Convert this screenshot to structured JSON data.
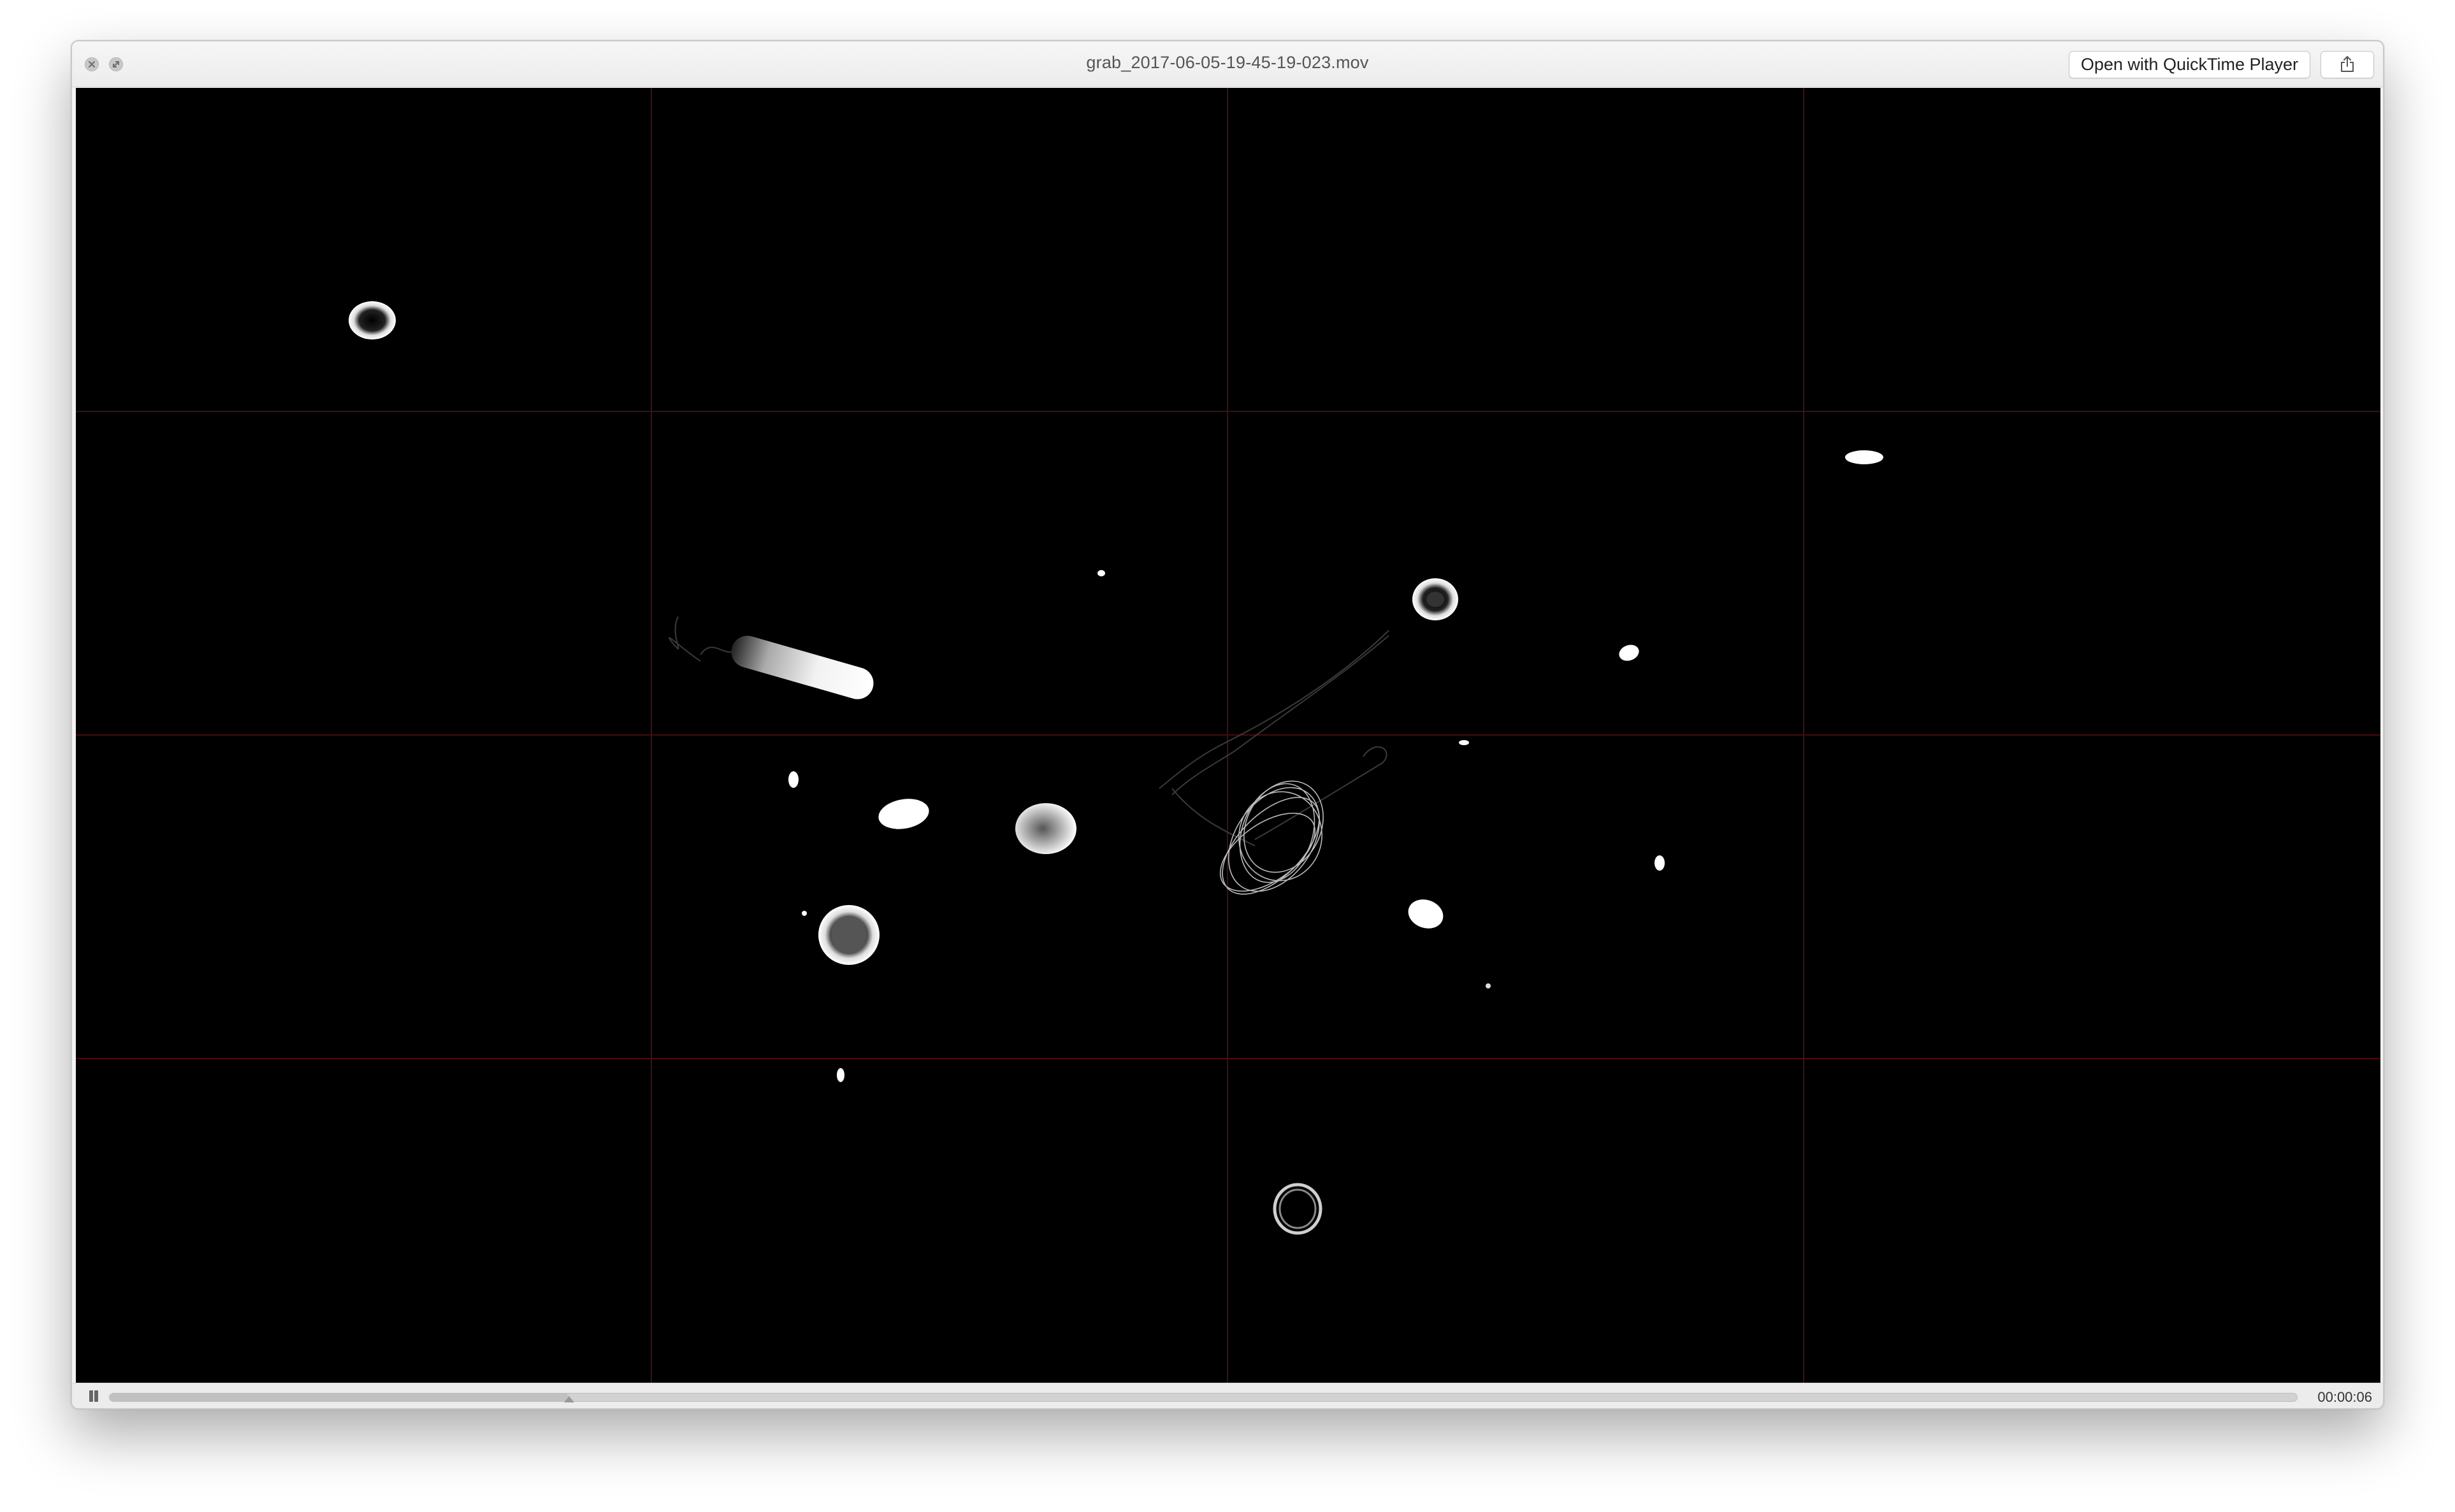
{
  "window": {
    "title": "grab_2017-06-05-19-45-19-023.mov",
    "open_button_label": "Open with QuickTime Player",
    "close_icon": "close-icon",
    "fullscreen_icon": "fullscreen-icon",
    "share_icon": "share-icon"
  },
  "player": {
    "elapsed_time": "00:00:06",
    "progress_fraction": 0.21,
    "pause_icon": "pause-icon"
  },
  "colors": {
    "grid": "#4a0a12",
    "video_background": "#000000",
    "particles": "#ffffff"
  }
}
